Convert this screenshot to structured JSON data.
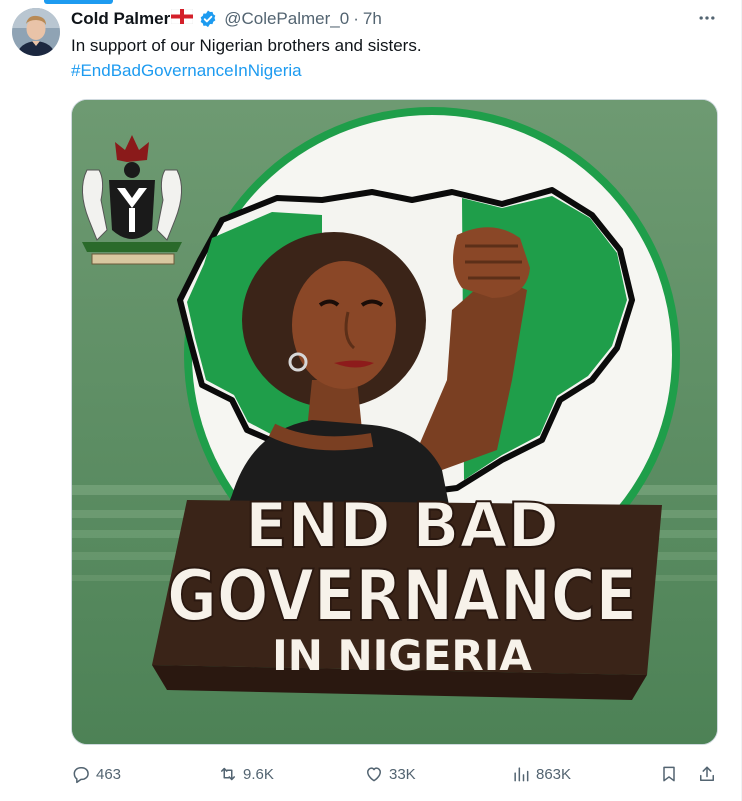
{
  "tweet": {
    "display_name": "Cold Palmer",
    "flag_emoji": "England flag",
    "handle": "@ColePalmer_0",
    "separator": "·",
    "timestamp": "7h",
    "text": "In support of our Nigerian brothers and sisters.",
    "hashtag": "#EndBadGovernanceInNigeria",
    "verified": true
  },
  "media": {
    "headline_line1": "END BAD",
    "headline_line2": "GOVERNANCE",
    "headline_line3": "IN NIGERIA"
  },
  "actions": {
    "replies": "463",
    "reposts": "9.6K",
    "likes": "33K",
    "views": "863K"
  },
  "colors": {
    "accent": "#1d9bf0",
    "nigeria_green": "#1f9e4a",
    "muted_text": "#536471"
  },
  "icons": {
    "reply": "reply-icon",
    "repost": "repost-icon",
    "like": "heart-icon",
    "views": "views-chart-icon",
    "bookmark": "bookmark-icon",
    "share": "share-icon",
    "more": "more-icon",
    "verified": "verified-badge-icon"
  }
}
